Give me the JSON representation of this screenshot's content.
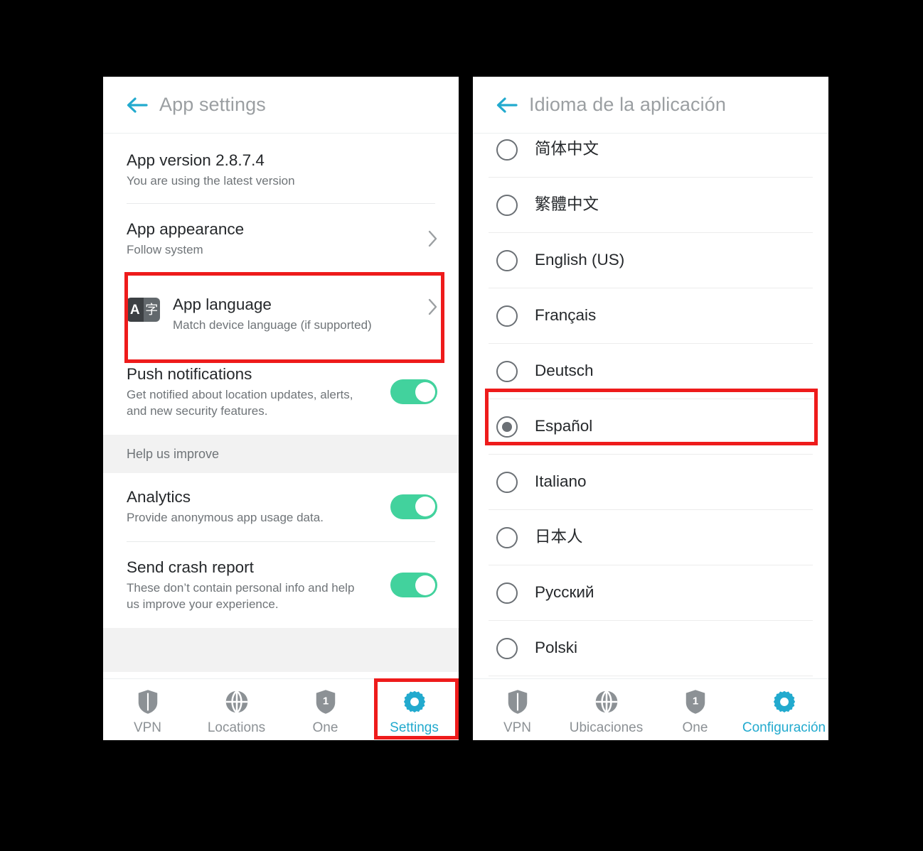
{
  "left_panel": {
    "appbar": {
      "title": "App settings",
      "back_icon": "back-arrow-icon"
    },
    "items": {
      "app_version": {
        "title": "App version 2.8.7.4",
        "subtitle": "You are using the latest version"
      },
      "app_appearance": {
        "title": "App appearance",
        "subtitle": "Follow system",
        "chevron_icon": "chevron-right-icon"
      },
      "app_language": {
        "title": "App language",
        "subtitle": "Match device language (if supported)",
        "icon_left_glyph": "A",
        "icon_right_glyph": "字",
        "icon_name": "app-language-icon",
        "chevron_icon": "chevron-right-icon"
      },
      "push_notifications": {
        "title": "Push notifications",
        "subtitle": "Get notified about location updates, alerts, and new security features.",
        "toggle_state": "on"
      }
    },
    "section_help": {
      "label": "Help us improve"
    },
    "help_items": [
      {
        "title": "Analytics",
        "subtitle": "Provide anonymous app usage data.",
        "toggle_state": "on"
      },
      {
        "title": "Send crash report",
        "subtitle": "These don’t contain personal info and help us improve your experience.",
        "toggle_state": "on"
      }
    ],
    "bottom_nav": {
      "items": [
        {
          "label": "VPN",
          "icon": "shield-icon",
          "active": false
        },
        {
          "label": "Locations",
          "icon": "globe-icon",
          "active": false
        },
        {
          "label": "One",
          "icon": "shield-one-icon",
          "active": false
        },
        {
          "label": "Settings",
          "icon": "gear-icon",
          "active": true
        }
      ]
    }
  },
  "right_panel": {
    "appbar": {
      "title": "Idioma de la aplicación",
      "back_icon": "back-arrow-icon"
    },
    "languages": [
      {
        "label": "简体中文",
        "selected": false
      },
      {
        "label": "繁體中文",
        "selected": false
      },
      {
        "label": "English (US)",
        "selected": false
      },
      {
        "label": "Français",
        "selected": false
      },
      {
        "label": "Deutsch",
        "selected": false
      },
      {
        "label": "Español",
        "selected": true
      },
      {
        "label": "Italiano",
        "selected": false
      },
      {
        "label": "日本人",
        "selected": false
      },
      {
        "label": "Русский",
        "selected": false
      },
      {
        "label": "Polski",
        "selected": false
      }
    ],
    "bottom_nav": {
      "items": [
        {
          "label": "VPN",
          "icon": "shield-icon",
          "active": false
        },
        {
          "label": "Ubicaciones",
          "icon": "globe-icon",
          "active": false
        },
        {
          "label": "One",
          "icon": "shield-one-icon",
          "active": false
        },
        {
          "label": "Configuración",
          "icon": "gear-icon",
          "active": true
        }
      ]
    }
  },
  "annotations": {
    "highlight_color": "#ee1b1b",
    "boxes": [
      {
        "name": "app-language-row-highlight"
      },
      {
        "name": "settings-tab-highlight"
      },
      {
        "name": "espanol-option-highlight"
      }
    ]
  },
  "theme": {
    "accent_cyan": "#22aace",
    "toggle_green": "#42d29d",
    "background": "#000000",
    "panel": "#ffffff",
    "section_gray": "#f2f2f2"
  }
}
